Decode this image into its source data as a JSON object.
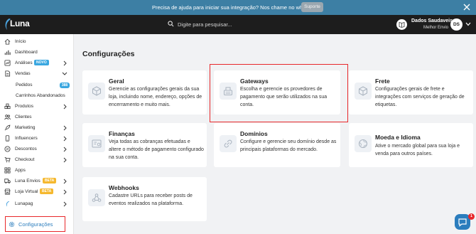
{
  "announcement": {
    "message": "Precisa de ajuda para iniciar sua integração? Nos chame no whatsapp",
    "button_label": "Suporte"
  },
  "header": {
    "logo_text": "Luna",
    "search_placeholder": "Digite para pesquisar...",
    "user_name": "Dados Saudaveis",
    "user_subtitle": "Melhor Envio",
    "avatar_initials": "DS"
  },
  "sidebar": {
    "items": [
      {
        "label": "Início"
      },
      {
        "label": "Dashboard"
      },
      {
        "label": "Análises",
        "badge": "NOVO"
      },
      {
        "label": "Vendas"
      },
      {
        "label": "Produtos"
      },
      {
        "label": "Clientes"
      },
      {
        "label": "Marketing"
      },
      {
        "label": "Influencers"
      },
      {
        "label": "Descontos"
      },
      {
        "label": "Checkout"
      },
      {
        "label": "Apps"
      },
      {
        "label": "Luna Envios",
        "badge": "BETA"
      },
      {
        "label": "Loja Virtual",
        "badge": "BETA"
      },
      {
        "label": "Lunapag"
      }
    ],
    "sub_items": [
      {
        "label": "Pedidos",
        "count": "388"
      },
      {
        "label": "Carrinhos Abandonados"
      }
    ],
    "active_item": "Configurações"
  },
  "main": {
    "title": "Configurações",
    "cards": [
      {
        "title": "Geral",
        "description": "Gerencie as configurações gerais da sua loja, incluindo nome, endereço, opções de encerramento e muito mais."
      },
      {
        "title": "Gateways",
        "description": "Escolha e gerencie os provedores de pagamento que serão utilizados na sua conta."
      },
      {
        "title": "Frete",
        "description": "Configurações gerais de frete e integrações com serviços de geração de etiquetas."
      },
      {
        "title": "Finanças",
        "description": "Veja todas as cobranças efetuadas e altere o método de pagamento configurado na sua conta."
      },
      {
        "title": "Domínios",
        "description": "Configure e gerencie seu domínio desde as principais plataformas do mercado."
      },
      {
        "title": "Moeda e Idioma",
        "description": "Ative o mercado global para sua loja e venda para outros países."
      },
      {
        "title": "Webhooks",
        "description": "Cadastre URLs para receber posts de eventos realizados na plataforma."
      }
    ]
  },
  "chat": {
    "unread": "1"
  },
  "colors": {
    "accent": "#2b7dbd",
    "announcement_bg": "#3d7fa4",
    "header_bg": "#1d1d1d",
    "highlight": "#e8282b",
    "badge_blue": "#3aa7e0",
    "badge_beta": "#f5b82e"
  }
}
